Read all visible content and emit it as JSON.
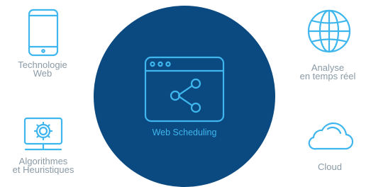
{
  "center": {
    "label": "Web Scheduling",
    "icon": "browser-share-icon"
  },
  "features": [
    {
      "label": "Technologie\nWeb",
      "icon": "smartphone-icon"
    },
    {
      "label": "Analyse\nen temps réel",
      "icon": "globe-icon"
    },
    {
      "label": "Algorithmes\net Heuristiques",
      "icon": "monitor-gear-icon"
    },
    {
      "label": "Cloud",
      "icon": "cloud-icon"
    }
  ],
  "colors": {
    "accent": "#3fb6ee",
    "circle": "#0b4a80",
    "label": "#8a9aa6"
  }
}
